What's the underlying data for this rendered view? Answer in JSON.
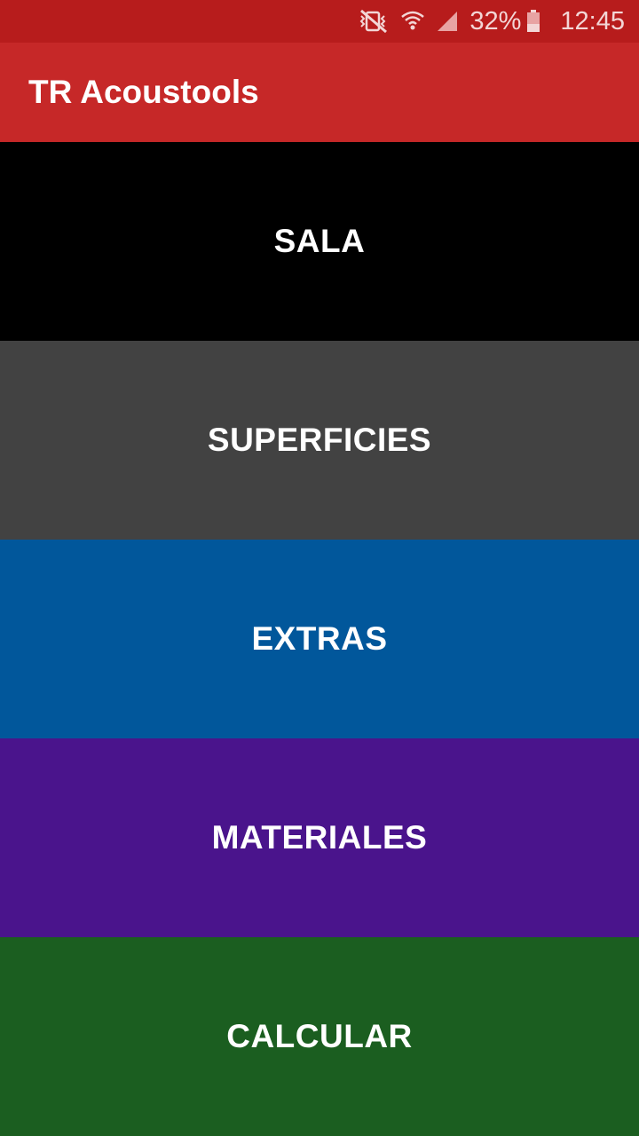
{
  "status_bar": {
    "icons": [
      "mute-vibrate-icon",
      "wifi-icon",
      "signal-icon",
      "battery-icon"
    ],
    "battery": "32%",
    "time": "12:45"
  },
  "app_bar": {
    "title": "TR Acoustools"
  },
  "menu": {
    "items": [
      {
        "label": "SALA",
        "color": "#000000"
      },
      {
        "label": "SUPERFICIES",
        "color": "#424242"
      },
      {
        "label": "EXTRAS",
        "color": "#01579b"
      },
      {
        "label": "MATERIALES",
        "color": "#4a148c"
      },
      {
        "label": "CALCULAR",
        "color": "#1b5e20"
      }
    ]
  }
}
